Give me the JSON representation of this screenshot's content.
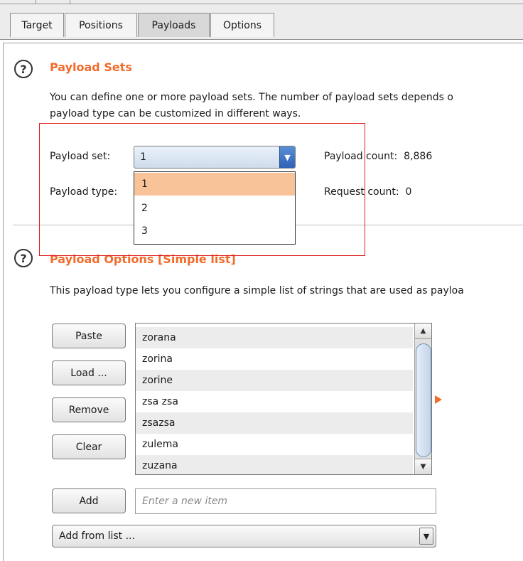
{
  "tabs": [
    {
      "label": "Target"
    },
    {
      "label": "Positions"
    },
    {
      "label": "Payloads"
    },
    {
      "label": "Options"
    }
  ],
  "active_tab": "Payloads",
  "payload_sets": {
    "help_glyph": "?",
    "title": "Payload Sets",
    "description_line1": "You can define one or more payload sets. The number of payload sets depends o",
    "description_line2": "payload type can be customized in different ways.",
    "payload_set_label": "Payload set:",
    "payload_set_value": "1",
    "payload_type_label": "Payload type:",
    "payload_count_label": "Payload count:",
    "payload_count_value": "8,886",
    "request_count_label": "Request count:",
    "request_count_value": "0",
    "dropdown_options": [
      "1",
      "2",
      "3"
    ],
    "selected_option": "1"
  },
  "payload_options": {
    "help_glyph": "?",
    "title": "Payload Options [Simple list]",
    "description": "This payload type lets you configure a simple list of strings that are used as payloa",
    "buttons": {
      "paste": "Paste",
      "load": "Load ...",
      "remove": "Remove",
      "clear": "Clear",
      "add": "Add"
    },
    "list_items": [
      "zorana",
      "zorina",
      "zorine",
      "zsa zsa",
      "zsazsa",
      "zulema",
      "zuzana"
    ],
    "new_item_placeholder": "Enter a new item",
    "add_from_list_label": "Add from list ..."
  },
  "colors": {
    "accent": "#f26b2a",
    "highlight_box": "#e01c1c",
    "dropdown_selected": "#f9c39a"
  },
  "icons": {
    "combo_arrow": "chevron-down-icon",
    "help": "question-circle-icon",
    "expand": "triangle-right-icon"
  }
}
